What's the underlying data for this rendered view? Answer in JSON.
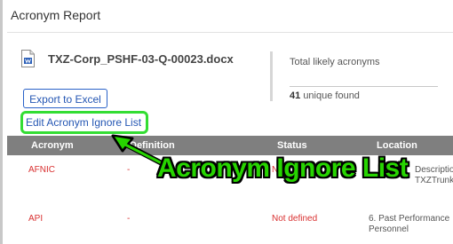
{
  "report": {
    "title": "Acronym Report"
  },
  "document": {
    "filename": "TXZ-Corp_PSHF-03-Q-00023.docx"
  },
  "summary": {
    "label": "Total likely acronyms",
    "count": "41",
    "count_suffix": "unique found"
  },
  "actions": {
    "export_label": "Export to Excel",
    "ignore_label": "Edit Acronym Ignore List"
  },
  "table": {
    "headers": [
      "Acronym",
      "Definition",
      "Status",
      "Location"
    ],
    "rows": [
      {
        "acronym": "AFNIC",
        "definition": "-",
        "status": "No",
        "location_line1": "ro",
        "location_line1b": "Description",
        "location_line2": "TXZTrunk"
      },
      {
        "acronym": "API",
        "definition": "-",
        "status": "Not defined",
        "location_line1": "6. Past Performance",
        "location_line2": "Personnel"
      }
    ]
  },
  "annotation": {
    "text": "Acronym Ignore List",
    "color": "#27d400"
  }
}
